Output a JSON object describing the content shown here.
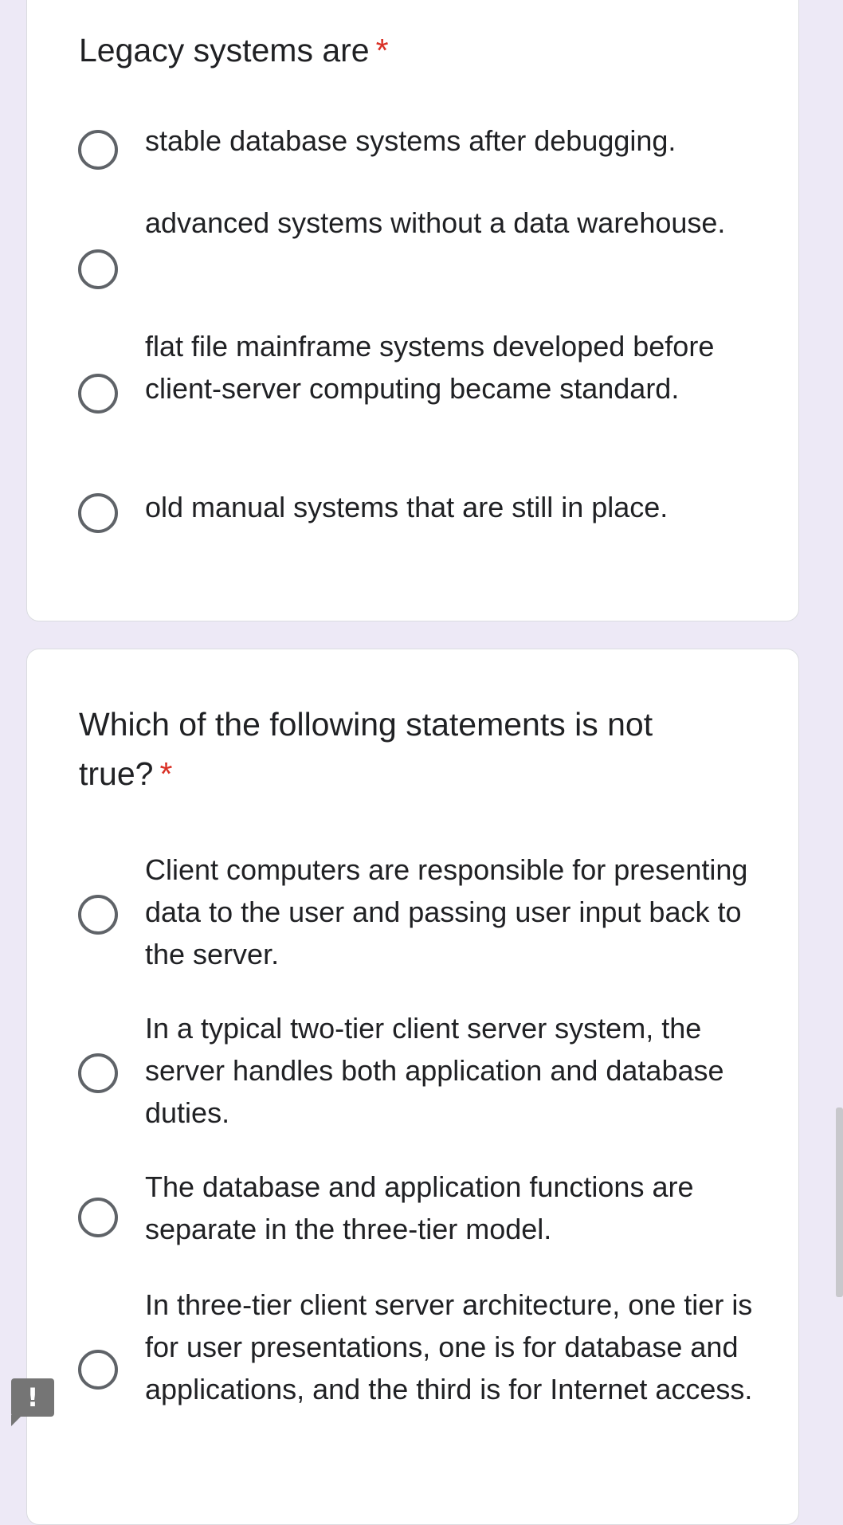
{
  "questions": [
    {
      "title": "Legacy systems are",
      "required_mark": "*",
      "options": [
        "stable database systems after debugging.",
        "advanced systems without a data warehouse.",
        "flat file mainframe systems developed before client-server computing became standard.",
        "old manual systems that are still in place."
      ]
    },
    {
      "title": "Which of the following statements is not true?",
      "required_mark": "*",
      "options": [
        "Client computers are responsible for presenting data to the user and passing user input back to the server.",
        "In a typical two-tier client server system, the server handles both application and database duties.",
        "The database and application functions are separate in the three-tier model.",
        "In three-tier client server architecture, one tier is for user presentations, one is for database and applications, and the third is for Internet access."
      ]
    }
  ],
  "feedback_button": {
    "glyph": "!",
    "icon": "report-issue-icon"
  },
  "colors": {
    "background": "#ede9f6",
    "card": "#ffffff",
    "required": "#d93025",
    "radio_border": "#5f6368",
    "text": "#202124"
  }
}
